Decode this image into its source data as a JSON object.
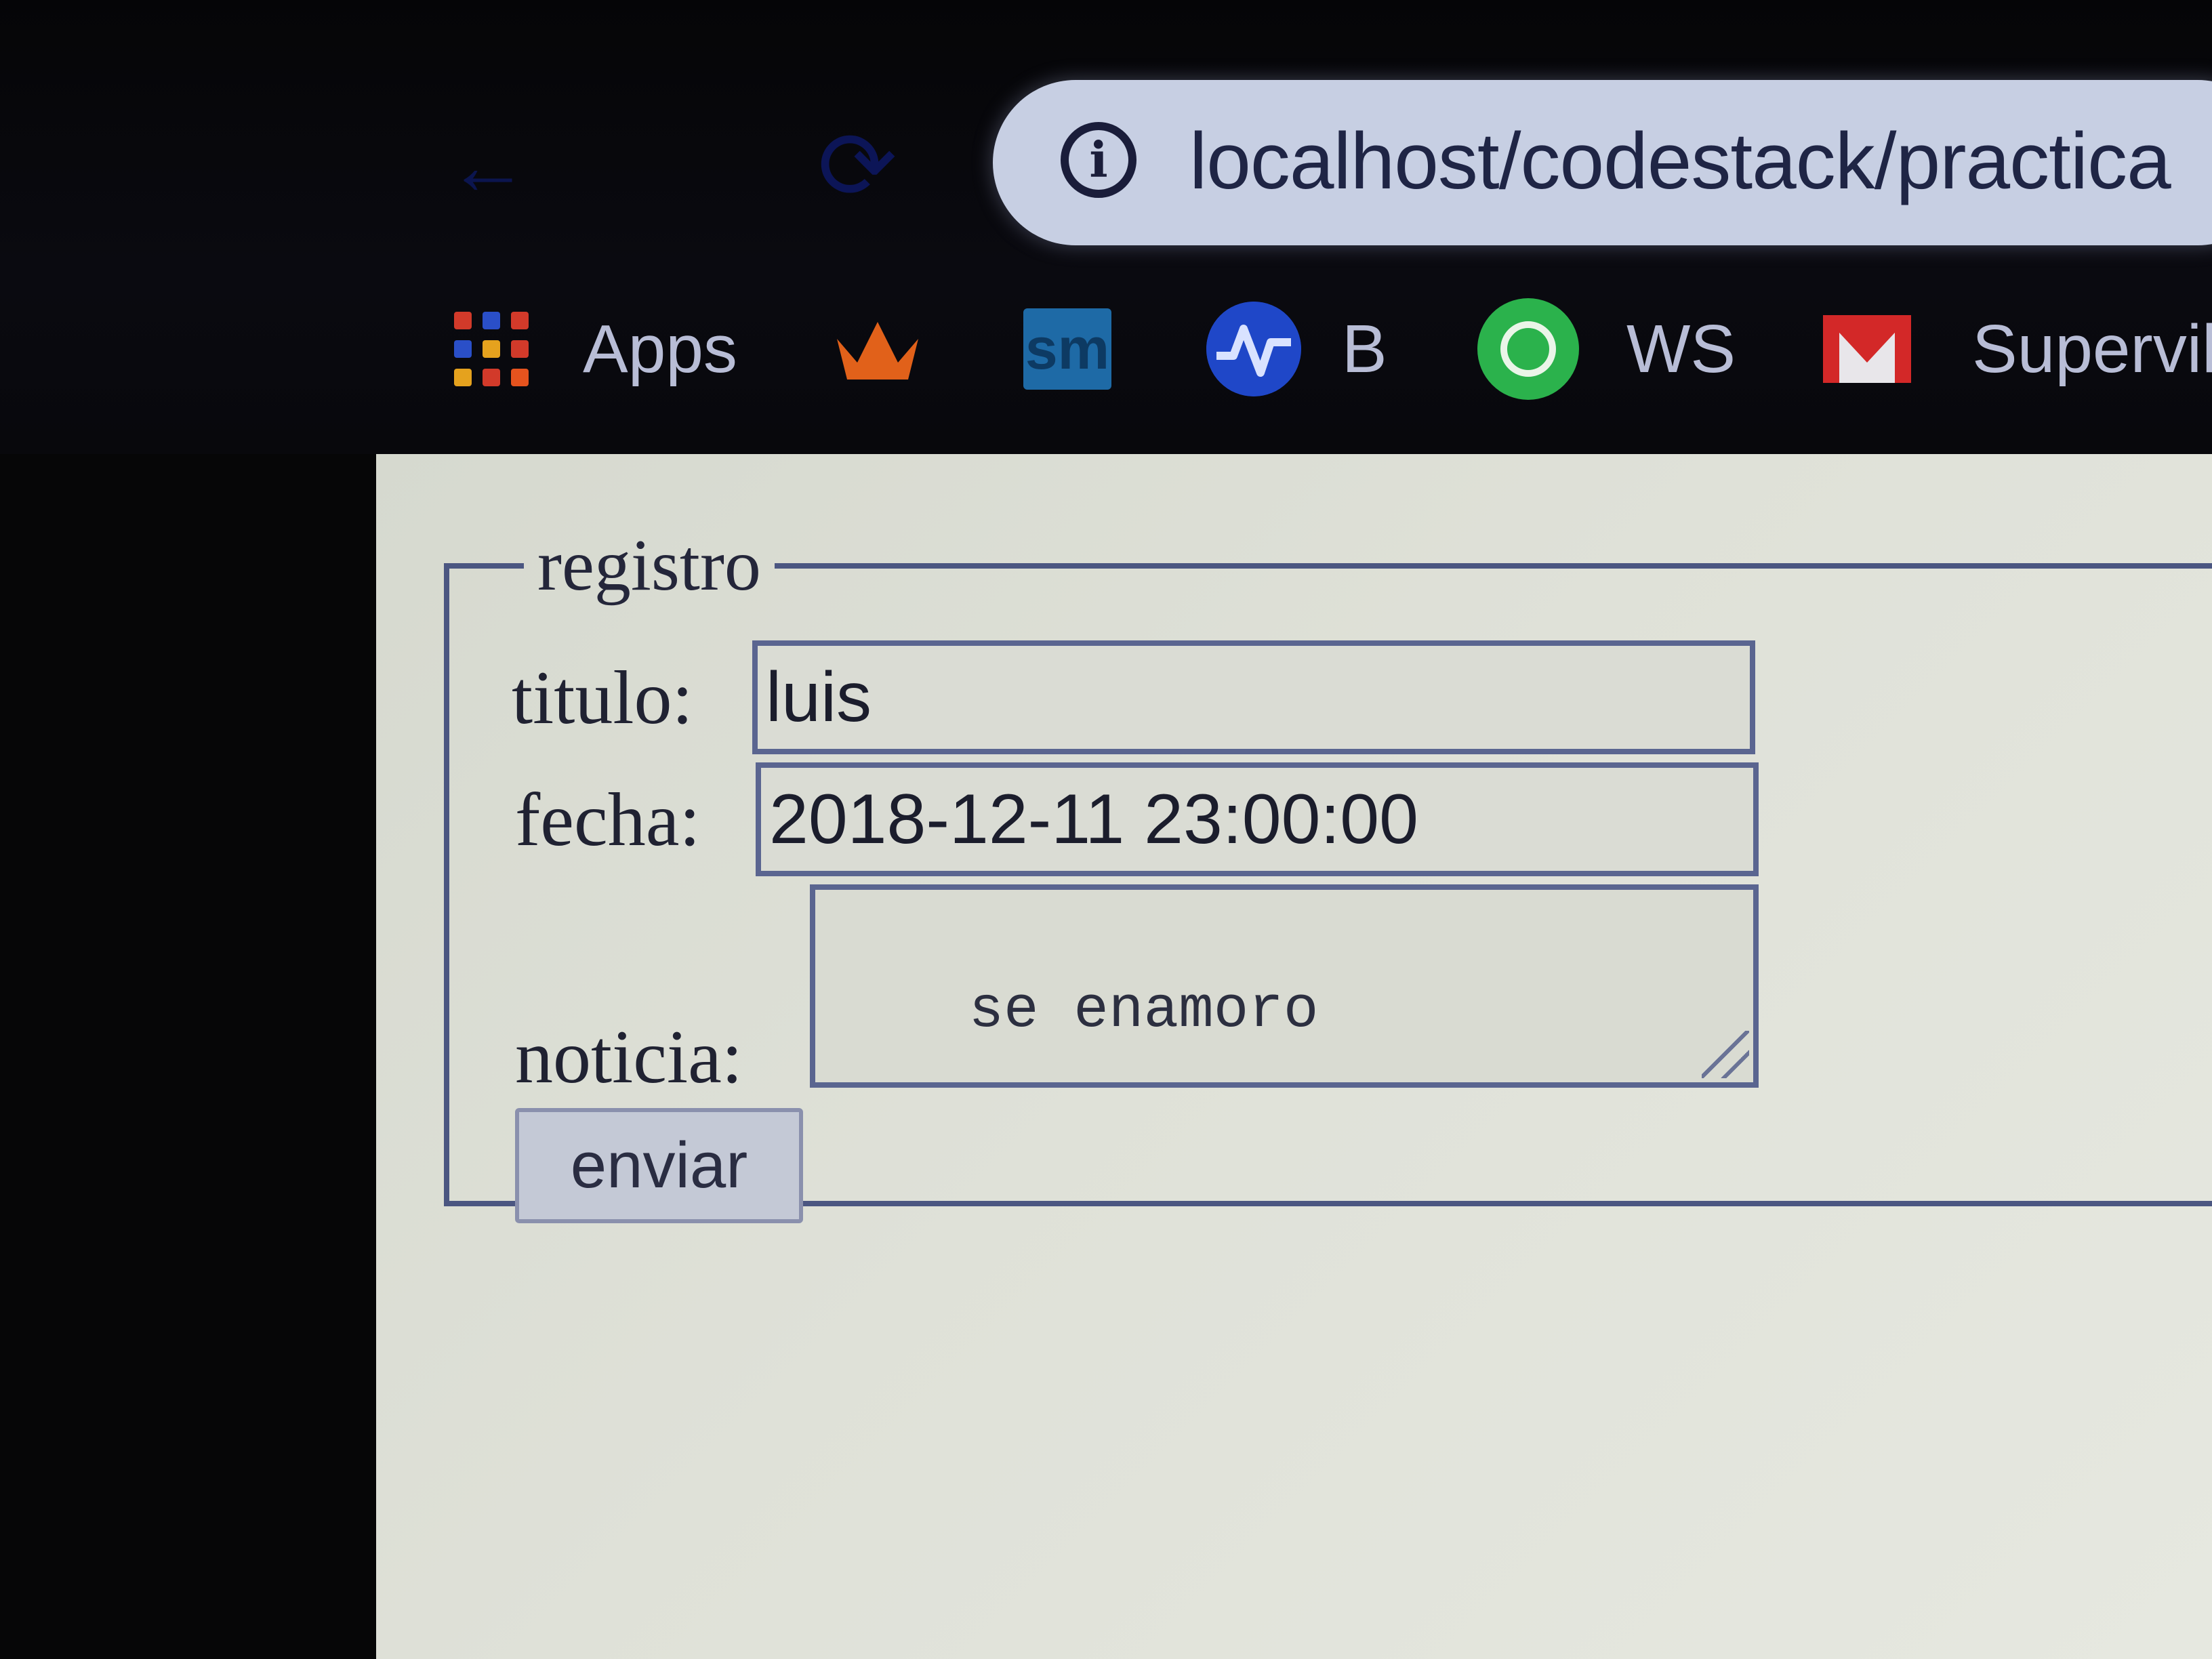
{
  "browser": {
    "address_bar": {
      "url": "localhost/codestack/practica"
    },
    "bookmarks": [
      {
        "label": "Apps",
        "icon": "apps-grid-icon"
      },
      {
        "label": "",
        "icon": "crown-icon"
      },
      {
        "label": "",
        "icon": "sm-icon",
        "icon_text": "sm"
      },
      {
        "label": "B",
        "icon": "waveform-icon"
      },
      {
        "label": "WS",
        "icon": "whatsapp-icon"
      },
      {
        "label": "Supervilc",
        "icon": "gmail-icon"
      }
    ]
  },
  "form": {
    "legend": "registro",
    "fields": {
      "titulo": {
        "label": "titulo:",
        "value": "luis"
      },
      "fecha": {
        "label": "fecha:",
        "value": "2018-12-11 23:00:00"
      },
      "noticia": {
        "label": "noticia:",
        "value": "se enamoro"
      }
    },
    "submit_label": "enviar"
  },
  "colors": {
    "border": "#4b5681",
    "page_background": "#dfe1d8",
    "omnibox": "#c7cfe3"
  }
}
